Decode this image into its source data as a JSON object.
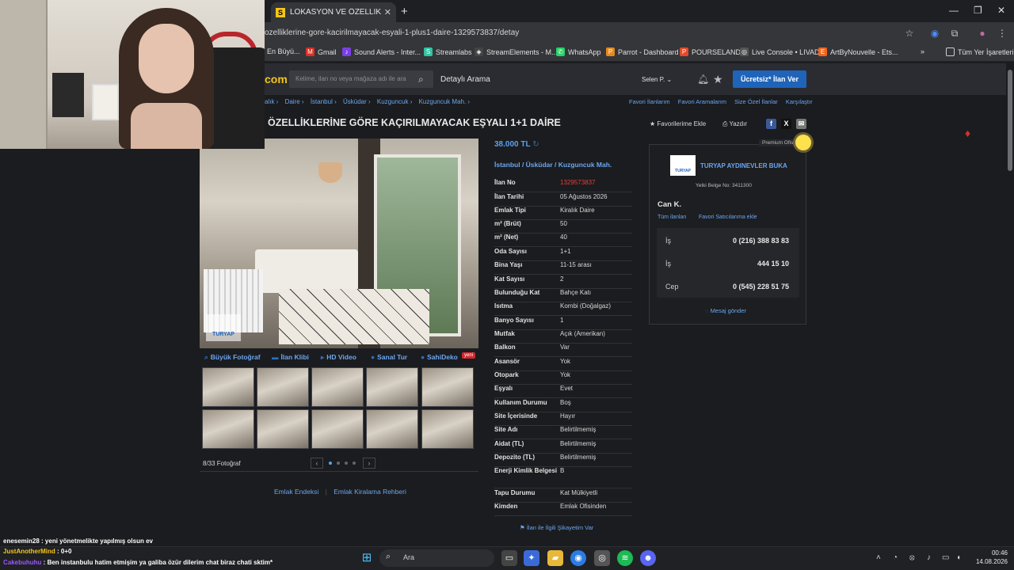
{
  "browser": {
    "tab_title": "LOKASYON VE ÖZELLİKLERİNE",
    "tab_favicon": "S",
    "new_tab": "+",
    "url": "ozelliklerine-gore-kacirilmayacak-esyali-1-plus1-daire-1329573837/detay",
    "bookmarks": [
      "En Büyü...",
      "Gmail",
      "Sound Alerts - Inter...",
      "Streamlabs",
      "StreamElements - M...",
      "WhatsApp",
      "Parrot - Dashboard",
      "POURSELAND",
      "Live Console • LIVAD",
      "ArtByNouvelle - Ets..."
    ],
    "bookmarks_more": "»",
    "all_bookmarks": "Tüm Yer İşaretleri"
  },
  "site": {
    "logo": "com",
    "search_placeholder": "Kelime, ilan no veya mağaza adı ile ara",
    "advanced_search": "Detaylı Arama",
    "user": "Selen P.",
    "post_button": "Ücretsiz* İlan Ver"
  },
  "breadcrumb": [
    "alık ›",
    "Daire ›",
    "İstanbul ›",
    "Üsküdar ›",
    "Kuzguncuk ›",
    "Kuzguncuk Mah. ›"
  ],
  "right_links": [
    "Favori İlanlarım",
    "Favori Aramalarım",
    "Size Özel İlanlar",
    "Karşılaştır"
  ],
  "listing": {
    "title": "ÖZELLİKLERİNE GÖRE KAÇIRILMAYACAK EŞYALI 1+1 DAİRE",
    "add_fav": "Favorilerime Ekle",
    "print": "Yazdır",
    "price": "38.000 TL",
    "location": "İstanbul  /  Üsküdar  /  Kuzguncuk Mah.",
    "photo_brand": "TURYAP",
    "photo_tabs": [
      "Büyük Fotoğraf",
      "İlan Klibi",
      "HD Video",
      "Sanal Tur",
      "SahiDeko"
    ],
    "new_badge": "yeni",
    "photo_count": "8/33 Fotoğraf",
    "bottom_links": [
      "Emlak Endeksi",
      "Emlak Kiralama Rehberi"
    ],
    "complain": "İlan ile İlgili Şikayetim Var",
    "details": [
      {
        "k": "İlan No",
        "v": "1329573837"
      },
      {
        "k": "İlan Tarihi",
        "v": "05 Ağustos 2026"
      },
      {
        "k": "Emlak Tipi",
        "v": "Kiralık Daire"
      },
      {
        "k": "m² (Brüt)",
        "v": "50"
      },
      {
        "k": "m² (Net)",
        "v": "40"
      },
      {
        "k": "Oda Sayısı",
        "v": "1+1"
      },
      {
        "k": "Bina Yaşı",
        "v": "11-15 arası"
      },
      {
        "k": "Kat Sayısı",
        "v": "2"
      },
      {
        "k": "Bulunduğu Kat",
        "v": "Bahçe Katı"
      },
      {
        "k": "Isıtma",
        "v": "Kombi (Doğalgaz)"
      },
      {
        "k": "Banyo Sayısı",
        "v": "1"
      },
      {
        "k": "Mutfak",
        "v": "Açık (Amerikan)"
      },
      {
        "k": "Balkon",
        "v": "Var"
      },
      {
        "k": "Asansör",
        "v": "Yok"
      },
      {
        "k": "Otopark",
        "v": "Yok"
      },
      {
        "k": "Eşyalı",
        "v": "Evet"
      },
      {
        "k": "Kullanım Durumu",
        "v": "Boş"
      },
      {
        "k": "Site İçerisinde",
        "v": "Hayır"
      },
      {
        "k": "Site Adı",
        "v": "Belirtilmemiş"
      },
      {
        "k": "Aidat (TL)",
        "v": "Belirtilmemiş"
      },
      {
        "k": "Depozito (TL)",
        "v": "Belirtilmemiş"
      },
      {
        "k": "Enerji Kimlik Belgesi",
        "v": "B"
      },
      {
        "k": "Tapu Durumu",
        "v": "Kat Mülkiyetli"
      },
      {
        "k": "Kimden",
        "v": "Emlak Ofisinden"
      }
    ]
  },
  "seller": {
    "premium": "Premium Ofis",
    "logo_text": "TURYAP",
    "office": "TURYAP AYDINEVLER BUKA",
    "license": "Yetki Belge No:  3411300",
    "agent": "Can K.",
    "all_listings": "Tüm ilanları",
    "fav_sellers": "Favori Satıcılarıma ekle",
    "phones": [
      {
        "type": "İş",
        "number": "0 (216) 388 83 83"
      },
      {
        "type": "İş",
        "number": "444 15 10"
      },
      {
        "type": "Cep",
        "number": "0 (545) 228 51 75"
      }
    ],
    "message": "Mesaj gönder"
  },
  "chat": [
    {
      "user": "enesemin28",
      "text": " : yeni yönetmelikte yapılmış olsun ev",
      "color": "#ffffff"
    },
    {
      "user": "JustAnotherMind",
      "text": " : 0+0",
      "color": "#f5c518"
    },
    {
      "user": "Cakebuhuhu",
      "text": " : Ben instanbulu hatim etmişim ya galiba özür dilerim chat biraz chati sktim*",
      "color": "#9b59ff"
    }
  ],
  "taskbar": {
    "search": "Ara",
    "time": "00:46",
    "date": "14.08.2026"
  }
}
